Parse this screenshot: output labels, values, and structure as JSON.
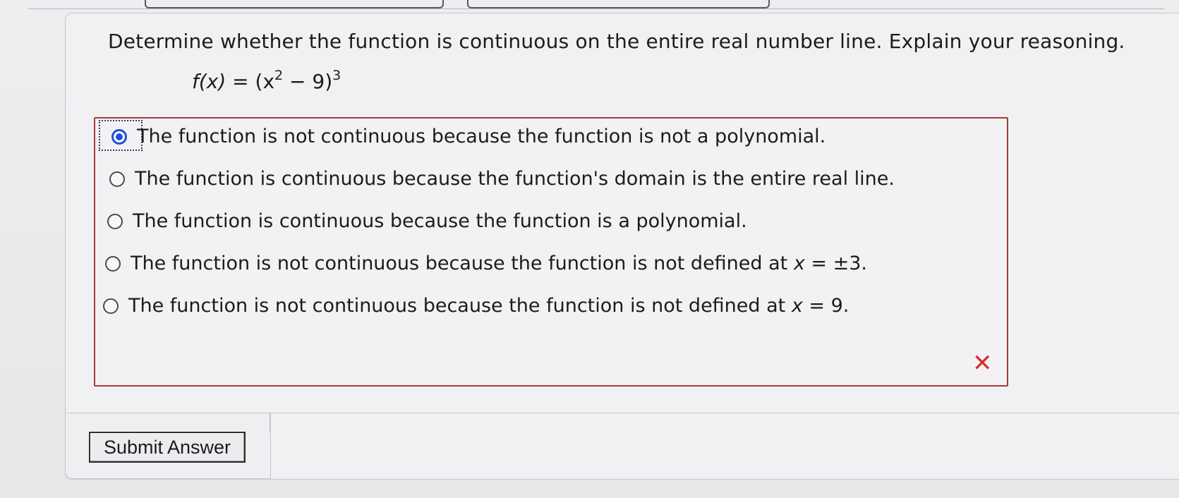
{
  "question": {
    "prompt": "Determine whether the function is continuous on the entire real number line. Explain your reasoning.",
    "function_name": "f(x)",
    "function_equals": " = (x",
    "exponent_inner": "2",
    "function_middle": " − 9)",
    "exponent_outer": "3"
  },
  "options": [
    {
      "text": "The function is not continuous because the function is not a polynomial.",
      "selected": true
    },
    {
      "text": "The function is continuous because the function's domain is the entire real line.",
      "selected": false
    },
    {
      "text": "The function is continuous because the function is a polynomial.",
      "selected": false
    },
    {
      "text_before": "The function is not continuous because the function is not defined at ",
      "var": "x",
      "text_after": " = ±3.",
      "selected": false
    },
    {
      "text_before": "The function is not continuous because the function is not defined at ",
      "var": "x",
      "text_after": " = 9.",
      "selected": false
    }
  ],
  "feedback": {
    "icon": "incorrect-x-icon",
    "glyph": "✕",
    "color": "#d62e2e"
  },
  "submit": {
    "label": "Submit Answer"
  },
  "colors": {
    "selected_radio": "#1d4fd8",
    "answer_border": "#a83a3a"
  }
}
